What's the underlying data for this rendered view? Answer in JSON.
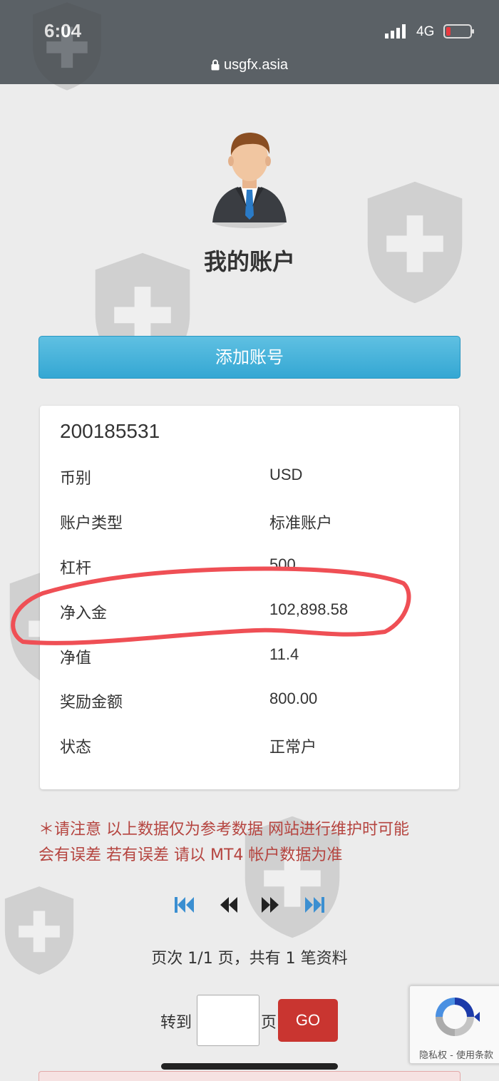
{
  "status_bar": {
    "time": "6:04",
    "network": "4G",
    "signal_icon": "signal-bars-icon",
    "battery_icon": "battery-low-icon"
  },
  "address_bar": {
    "url": "usgfx.asia",
    "lock_icon": "lock-icon"
  },
  "page": {
    "avatar_icon": "user-avatar-icon",
    "title": "我的账户",
    "add_account_button": "添加账号"
  },
  "account": {
    "number": "200185531",
    "fields": [
      {
        "label": "币别",
        "value": "USD"
      },
      {
        "label": "账户类型",
        "value": "标准账户"
      },
      {
        "label": "杠杆",
        "value": "500"
      },
      {
        "label": "净入金",
        "value": "102,898.58"
      },
      {
        "label": "净值",
        "value": "11.4"
      },
      {
        "label": "奖励金额",
        "value": "800.00"
      },
      {
        "label": "状态",
        "value": "正常户"
      }
    ]
  },
  "notice": {
    "line1": "＊请注意 以上数据仅为参考数据 网站进行维护时可能",
    "line2": "会有误差 若有误差 请以 MT4 帐户数据为准"
  },
  "pagination": {
    "first_icon": "first-page-icon",
    "prev_icon": "prev-page-icon",
    "next_icon": "next-page-icon",
    "last_icon": "last-page-icon",
    "info": "页次 1/1 页，共有 1 笔资料",
    "goto_label": "转到",
    "goto_value": "",
    "page_suffix": "页",
    "go_button": "GO"
  },
  "recaptcha": {
    "terms": "隐私权 - 使用条款"
  },
  "colors": {
    "primary_button": "#34a7d3",
    "go_button": "#c93530",
    "notice_text": "#b5443f",
    "highlight_stroke": "#ef4f55",
    "pager_active": "#3b8fd1"
  }
}
